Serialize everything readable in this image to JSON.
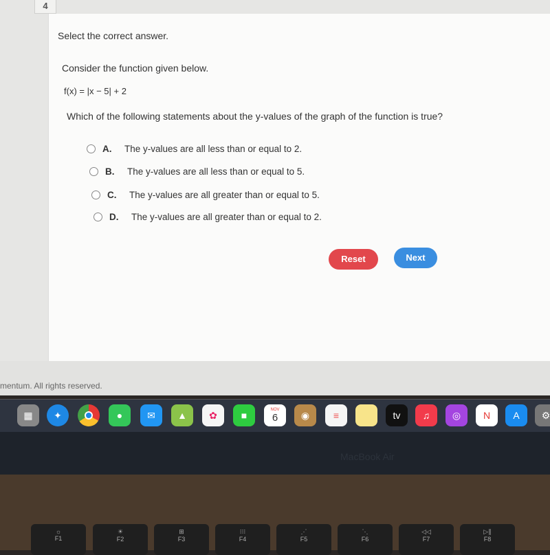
{
  "question_number": "4",
  "instruction": "Select the correct answer.",
  "prompt": "Consider the function given below.",
  "function": "f(x) = |x − 5| + 2",
  "question": "Which of the following statements about the y-values of the graph of the function is true?",
  "options": [
    {
      "letter": "A.",
      "text": "The y-values are all less than or equal to 2."
    },
    {
      "letter": "B.",
      "text": "The y-values are all less than or equal to 5."
    },
    {
      "letter": "C.",
      "text": "The y-values are all greater than or equal to 5."
    },
    {
      "letter": "D.",
      "text": "The y-values are all greater than or equal to 2."
    }
  ],
  "buttons": {
    "reset": "Reset",
    "next": "Next"
  },
  "colors": {
    "reset": "#e2474c",
    "next": "#3a8ee0"
  },
  "copyright": "mentum. All rights reserved.",
  "dock": {
    "calendar_month": "NOV",
    "calendar_day": "6",
    "tv": "tv"
  },
  "laptop_label": "MacBook Air",
  "keys": [
    "F1",
    "F2",
    "F3",
    "F4",
    "F5",
    "F6",
    "F7",
    "F8"
  ]
}
